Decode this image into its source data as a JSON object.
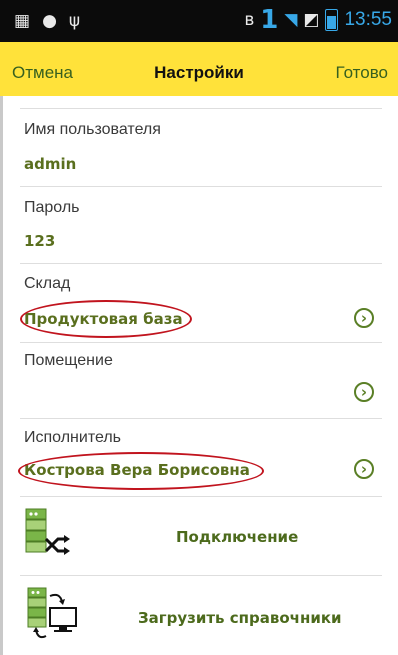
{
  "status_bar": {
    "time": "13:55",
    "sim_number": "1",
    "icons": [
      "image-icon",
      "android-icon",
      "usb-icon",
      "bluetooth-icon",
      "wifi-icon",
      "no-sim-icon",
      "battery-icon"
    ]
  },
  "nav": {
    "cancel": "Отмена",
    "title": "Настройки",
    "done": "Готово"
  },
  "fields": {
    "username": {
      "label": "Имя пользователя",
      "value": "admin"
    },
    "password": {
      "label": "Пароль",
      "value": "123"
    },
    "warehouse": {
      "label": "Склад",
      "value": "Продуктовая база"
    },
    "room": {
      "label": "Помещение",
      "value": ""
    },
    "executor": {
      "label": "Исполнитель",
      "value": "Кострова Вера Борисовна"
    }
  },
  "actions": {
    "connection": "Подключение",
    "load_references": "Загрузить справочники"
  },
  "colors": {
    "nav_background": "#ffe23a",
    "value_text": "#5a6f1e",
    "highlight_oval": "#c1141e",
    "status_accent": "#38a8e8"
  }
}
